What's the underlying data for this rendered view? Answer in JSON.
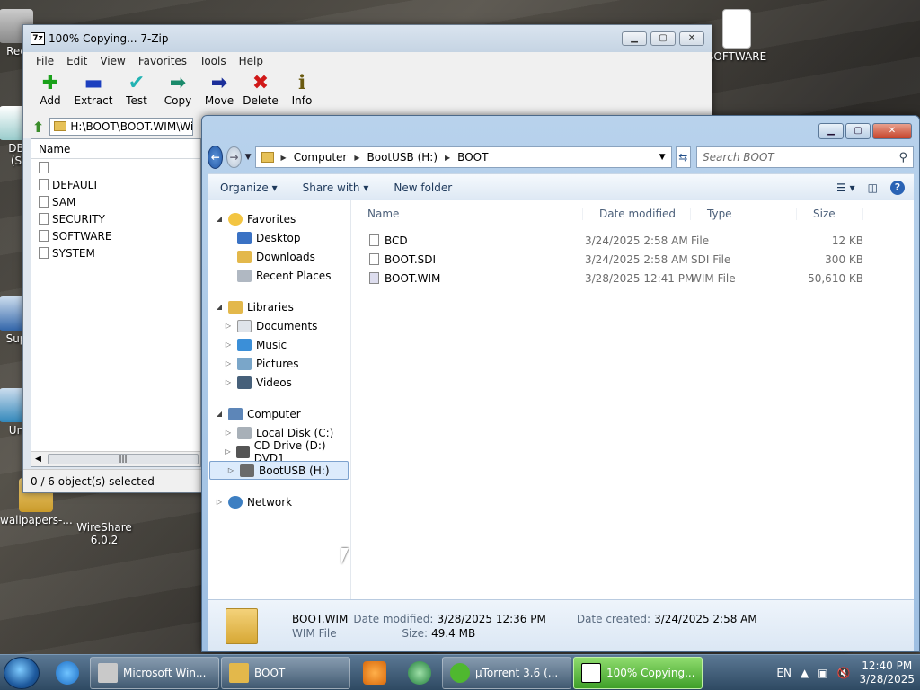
{
  "desktop": {
    "icons": [
      {
        "label": "Rec"
      },
      {
        "label": "DB\n(S"
      },
      {
        "label": "Sup"
      },
      {
        "label": "Un"
      },
      {
        "label": "wallpapers-..."
      },
      {
        "label": "WireShare\n6.0.2"
      },
      {
        "label": "SOFTWARE"
      }
    ]
  },
  "sevenzip": {
    "title": "100% Copying... 7-Zip",
    "app_icon": "7z",
    "menu": [
      "File",
      "Edit",
      "View",
      "Favorites",
      "Tools",
      "Help"
    ],
    "toolbar": [
      {
        "label": "Add",
        "glyph": "✚",
        "color": "#1aa11a"
      },
      {
        "label": "Extract",
        "glyph": "▬",
        "color": "#1c3fbf"
      },
      {
        "label": "Test",
        "glyph": "✔",
        "color": "#22b3b3"
      },
      {
        "label": "Copy",
        "glyph": "➡",
        "color": "#1a8a6b"
      },
      {
        "label": "Move",
        "glyph": "➡",
        "color": "#1c2f9a"
      },
      {
        "label": "Delete",
        "glyph": "✖",
        "color": "#d01818"
      },
      {
        "label": "Info",
        "glyph": "ℹ",
        "color": "#6a5a10"
      }
    ],
    "address": "H:\\BOOT\\BOOT.WIM\\Wi",
    "list_header": "Name",
    "files": [
      "",
      "DEFAULT",
      "SAM",
      "SECURITY",
      "SOFTWARE",
      "SYSTEM"
    ],
    "status": "0 / 6 object(s) selected"
  },
  "explorer": {
    "breadcrumbs": [
      "Computer",
      "BootUSB (H:)",
      "BOOT"
    ],
    "search_placeholder": "Search BOOT",
    "commands": [
      "Organize ▾",
      "Share with ▾",
      "New folder"
    ],
    "nav": {
      "favorites": {
        "label": "Favorites",
        "items": [
          "Desktop",
          "Downloads",
          "Recent Places"
        ]
      },
      "libraries": {
        "label": "Libraries",
        "items": [
          "Documents",
          "Music",
          "Pictures",
          "Videos"
        ]
      },
      "computer": {
        "label": "Computer",
        "items": [
          "Local Disk (C:)",
          "CD Drive (D:) DVD1",
          "BootUSB (H:)"
        ]
      },
      "network": {
        "label": "Network"
      }
    },
    "columns": [
      "Name",
      "Date modified",
      "Type",
      "Size"
    ],
    "files": [
      {
        "name": "BCD",
        "date": "3/24/2025 2:58 AM",
        "type": "File",
        "size": "12 KB"
      },
      {
        "name": "BOOT.SDI",
        "date": "3/24/2025 2:58 AM",
        "type": "SDI File",
        "size": "300 KB"
      },
      {
        "name": "BOOT.WIM",
        "date": "3/28/2025 12:41 PM",
        "type": "WIM File",
        "size": "50,610 KB"
      }
    ],
    "details": {
      "name": "BOOT.WIM",
      "modified_label": "Date modified:",
      "modified": "3/28/2025 12:36 PM",
      "created_label": "Date created:",
      "created": "3/24/2025 2:58 AM",
      "type": "WIM File",
      "size_label": "Size:",
      "size": "49.4 MB"
    }
  },
  "taskbar": {
    "buttons": [
      {
        "label": "Microsoft Win...",
        "color": "#c9c9c9"
      },
      {
        "label": "BOOT",
        "color": "#e3b84b"
      },
      {
        "label": "µTorrent 3.6  (...",
        "color": "#4fb82f"
      },
      {
        "label": "100% Copying...",
        "color": "#ffffff"
      }
    ],
    "lang": "EN",
    "time": "12:40 PM",
    "date": "3/28/2025"
  }
}
